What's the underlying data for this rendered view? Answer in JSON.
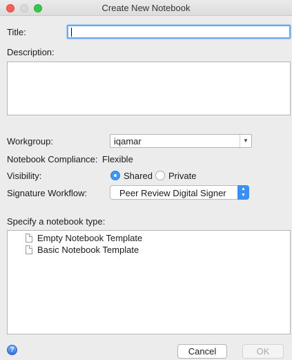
{
  "window": {
    "title": "Create New Notebook"
  },
  "form": {
    "title_label": "Title:",
    "title_value": "",
    "description_label": "Description:",
    "description_value": "",
    "workgroup_label": "Workgroup:",
    "workgroup_value": "iqamar",
    "compliance_label": "Notebook Compliance:",
    "compliance_value": "Flexible",
    "visibility_label": "Visibility:",
    "visibility_options": [
      {
        "label": "Shared",
        "selected": true
      },
      {
        "label": "Private",
        "selected": false
      }
    ],
    "signature_label": "Signature Workflow:",
    "signature_value": "Peer Review Digital Signer",
    "type_label": "Specify a notebook type:",
    "templates": [
      {
        "label": "Empty Notebook Template",
        "icon": "document-icon"
      },
      {
        "label": "Basic Notebook Template",
        "icon": "document-icon"
      }
    ]
  },
  "footer": {
    "help_icon": "?",
    "cancel_label": "Cancel",
    "ok_label": "OK",
    "ok_enabled": false
  },
  "colors": {
    "accent": "#3b99fc",
    "focus_ring": "#6aa9ef",
    "close_light": "#fc5f57",
    "zoom_light": "#34c84a"
  }
}
